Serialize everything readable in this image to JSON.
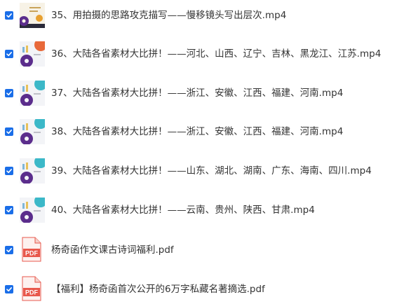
{
  "colors": {
    "checkbox": "#1a6ee8",
    "pdf_icon": "#e8584c",
    "text": "#333333"
  },
  "files": [
    {
      "name": "35、用拍摄的思路攻克描写——慢移镜头写出层次.mp4",
      "icon": "video-thumbnail-icon",
      "checked": true
    },
    {
      "name": "36、大陆各省素材大比拼！——河北、山西、辽宁、吉林、黑龙江、江苏.mp4",
      "icon": "video-thumbnail-icon",
      "checked": true
    },
    {
      "name": "37、大陆各省素材大比拼！——浙江、安徽、江西、福建、河南.mp4",
      "icon": "video-thumbnail-icon",
      "checked": true
    },
    {
      "name": "38、大陆各省素材大比拼！——浙江、安徽、江西、福建、河南.mp4",
      "icon": "video-thumbnail-icon",
      "checked": true
    },
    {
      "name": "39、大陆各省素材大比拼！——山东、湖北、湖南、广东、海南、四川.mp4",
      "icon": "video-thumbnail-icon",
      "checked": true
    },
    {
      "name": "40、大陆各省素材大比拼！——云南、贵州、陕西、甘肃.mp4",
      "icon": "video-thumbnail-icon",
      "checked": true
    },
    {
      "name": "杨奇函作文课古诗词福利.pdf",
      "icon": "pdf-icon",
      "icon_text": "PDF",
      "checked": true
    },
    {
      "name": "【福利】杨奇函首次公开的6万字私藏名著摘选.pdf",
      "icon": "pdf-icon",
      "icon_text": "PDF",
      "checked": true
    }
  ]
}
